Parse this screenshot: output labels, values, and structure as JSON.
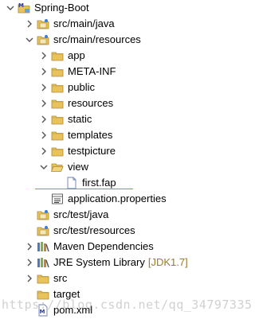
{
  "tree": {
    "rows": [
      {
        "label": "Spring-Boot",
        "icon": "project-icon",
        "twisty": "expanded",
        "indent": 0
      },
      {
        "label": "src/main/java",
        "icon": "source-folder-icon",
        "twisty": "collapsed",
        "indent": 1
      },
      {
        "label": "src/main/resources",
        "icon": "source-folder-icon",
        "twisty": "expanded",
        "indent": 1
      },
      {
        "label": "app",
        "icon": "folder-icon",
        "twisty": "collapsed",
        "indent": 2
      },
      {
        "label": "META-INF",
        "icon": "folder-icon",
        "twisty": "collapsed",
        "indent": 2
      },
      {
        "label": "public",
        "icon": "folder-icon",
        "twisty": "collapsed",
        "indent": 2
      },
      {
        "label": "resources",
        "icon": "folder-icon",
        "twisty": "collapsed",
        "indent": 2
      },
      {
        "label": "static",
        "icon": "folder-icon",
        "twisty": "collapsed",
        "indent": 2
      },
      {
        "label": "templates",
        "icon": "folder-icon",
        "twisty": "collapsed",
        "indent": 2
      },
      {
        "label": "testpicture",
        "icon": "folder-icon",
        "twisty": "collapsed",
        "indent": 2
      },
      {
        "label": "view",
        "icon": "open-folder-icon",
        "twisty": "expanded",
        "indent": 2
      },
      {
        "label": "first.fap",
        "icon": "file-icon",
        "twisty": "none",
        "indent": 3
      },
      {
        "label": "application.properties",
        "icon": "properties-file-icon",
        "twisty": "none",
        "indent": 2
      },
      {
        "label": "src/test/java",
        "icon": "source-folder-icon",
        "twisty": "none",
        "indent": 1
      },
      {
        "label": "src/test/resources",
        "icon": "source-folder-icon",
        "twisty": "none",
        "indent": 1
      },
      {
        "label": "Maven Dependencies",
        "icon": "library-icon",
        "twisty": "collapsed",
        "indent": 1
      },
      {
        "label": "JRE System Library",
        "decoration": "[JDK1.7]",
        "icon": "library-icon",
        "twisty": "collapsed",
        "indent": 1
      },
      {
        "label": "src",
        "icon": "folder-icon",
        "twisty": "collapsed",
        "indent": 1
      },
      {
        "label": "target",
        "icon": "folder-icon",
        "twisty": "none",
        "indent": 1
      },
      {
        "label": "pom.xml",
        "icon": "xml-file-icon",
        "twisty": "none",
        "indent": 1
      }
    ]
  },
  "watermark": "https://blog.csdn.net/qq_34797335"
}
